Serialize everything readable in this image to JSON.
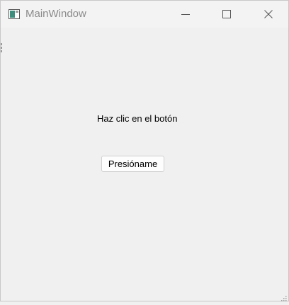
{
  "window": {
    "title": "MainWindow"
  },
  "main": {
    "label_text": "Haz clic en el botón",
    "button_label": "Presióname"
  },
  "icons": {
    "app": "app-window-icon",
    "minimize": "minimize-icon",
    "maximize": "maximize-icon",
    "close": "close-icon",
    "resize": "resize-grip-icon"
  },
  "colors": {
    "background": "#f0f0f0",
    "titlebar": "#f3f3f3",
    "title_text": "#8a8a8a",
    "icon_accent": "#2e7d6d"
  }
}
